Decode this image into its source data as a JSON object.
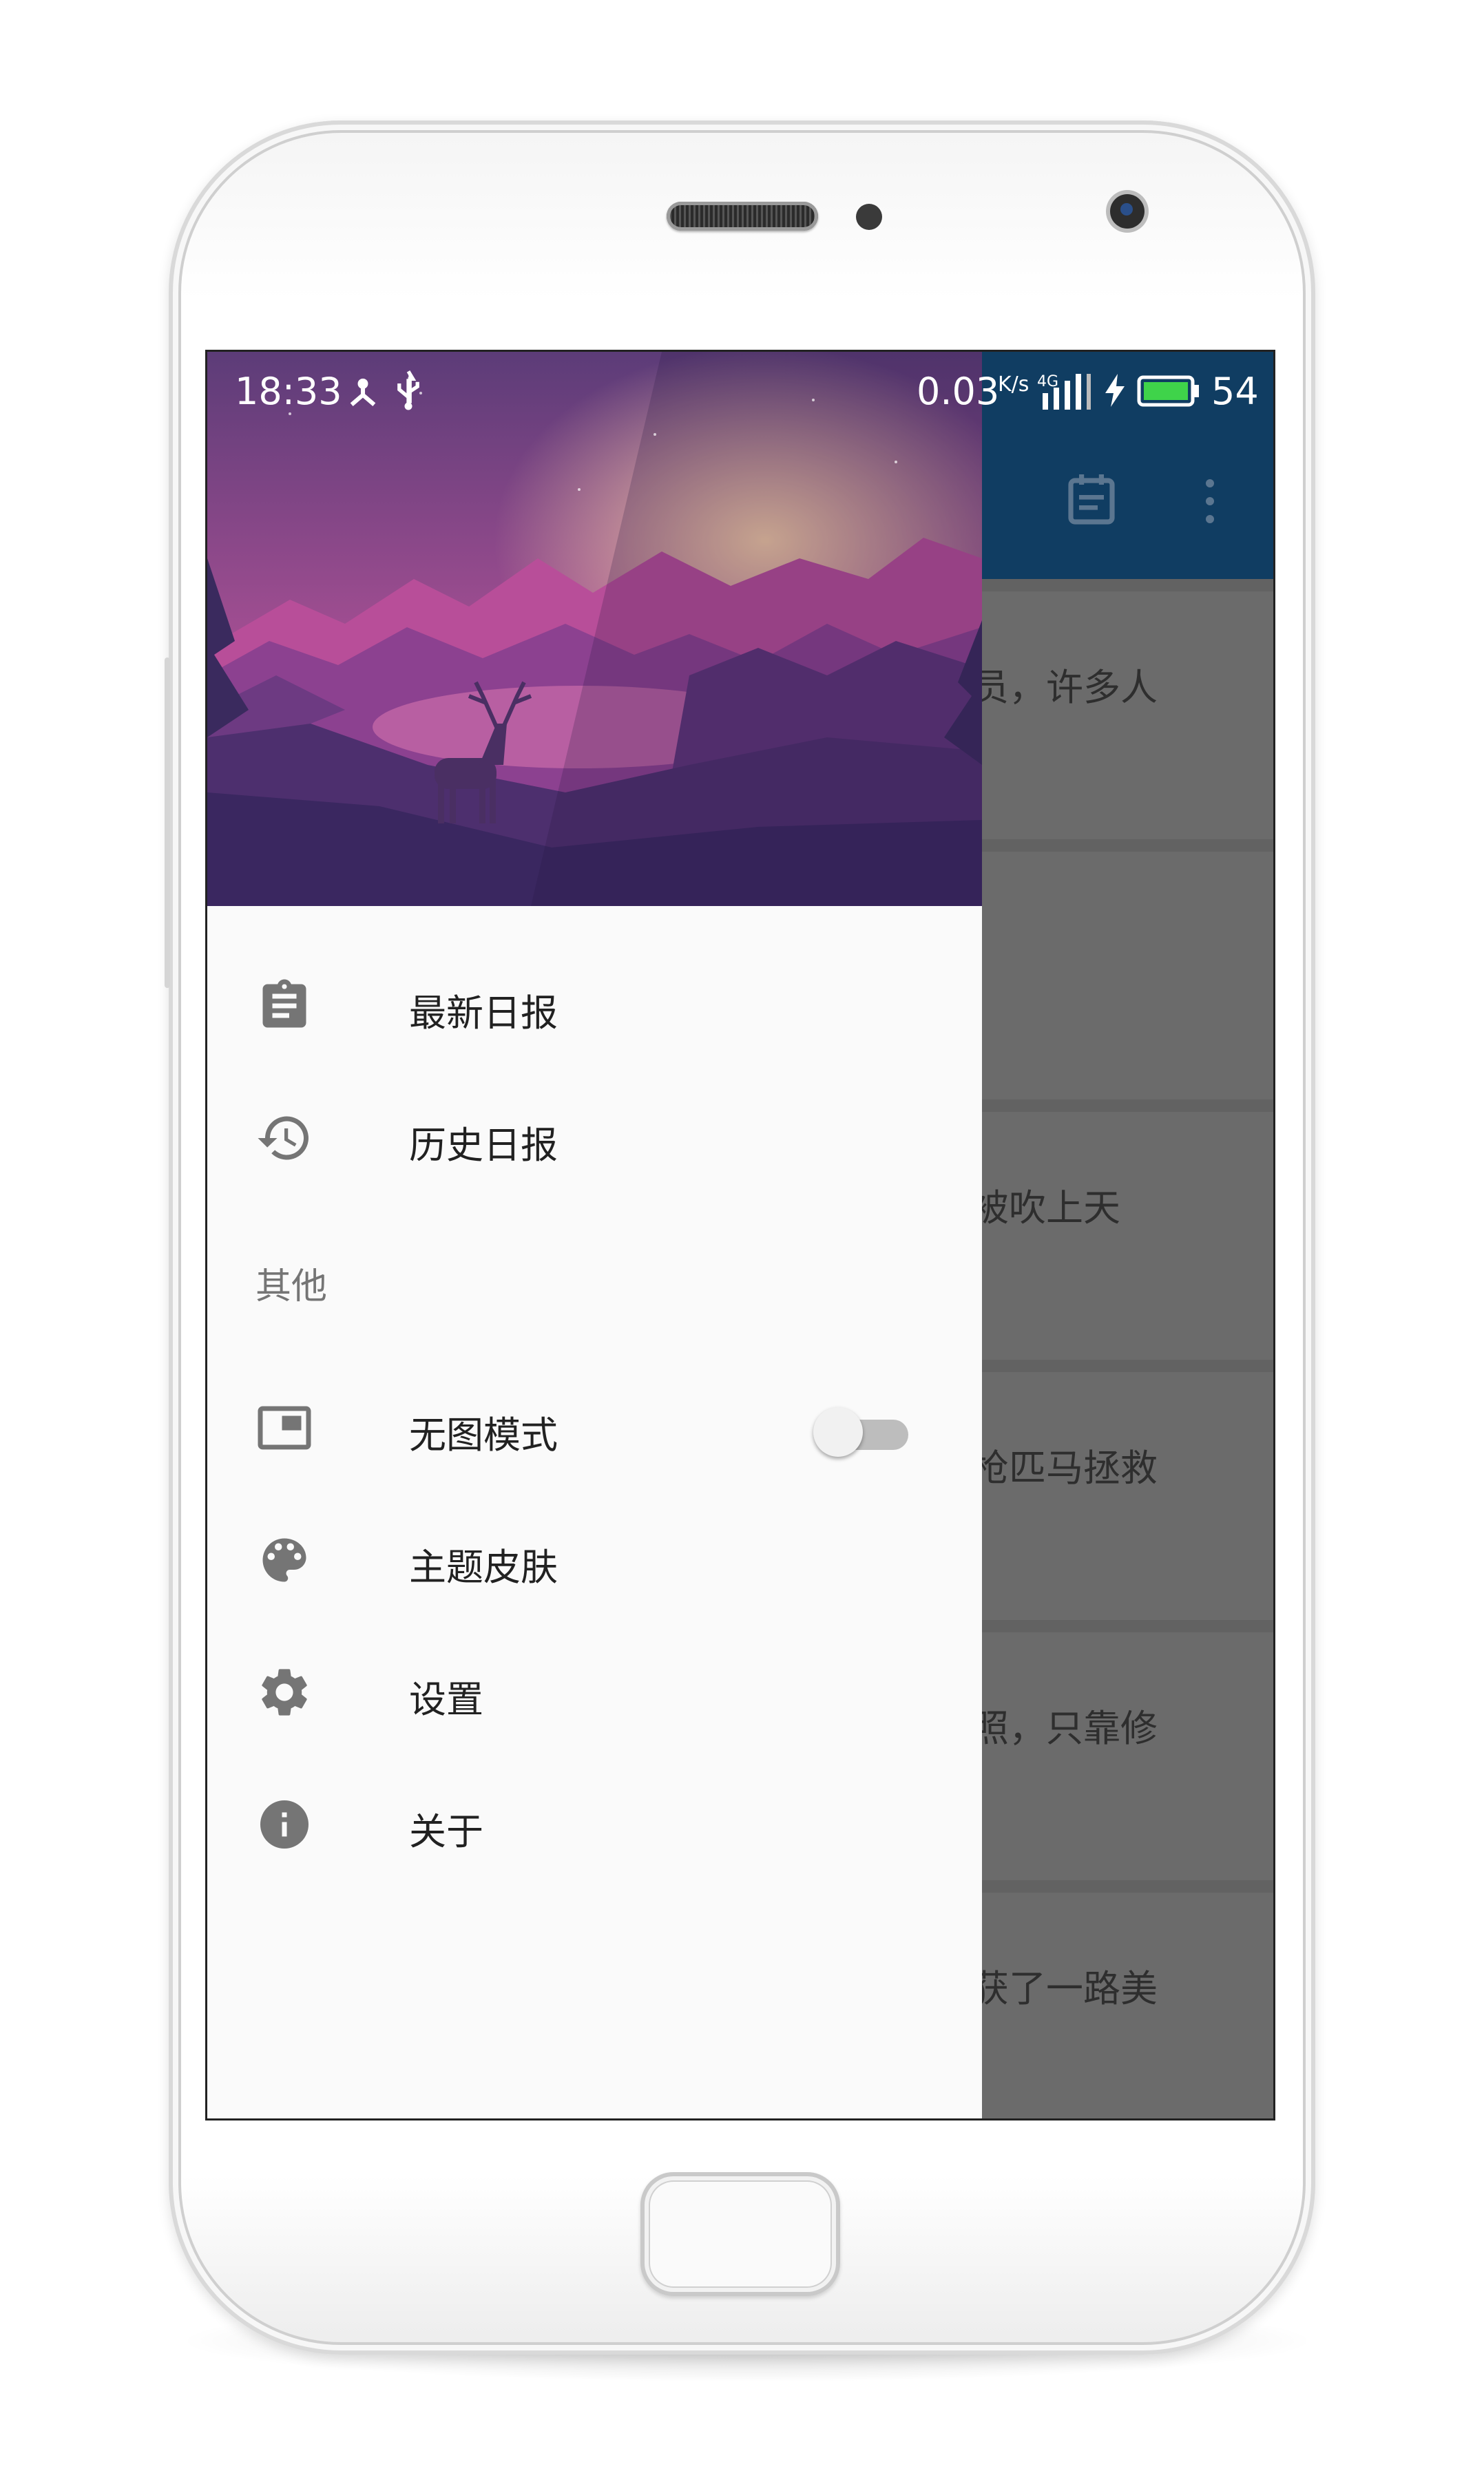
{
  "status_bar": {
    "time": "18:33",
    "net_speed": "0.03",
    "net_unit": "K/s",
    "network_type": "4G",
    "battery_level": "54"
  },
  "background_app": {
    "toolbar_color": "#103d62",
    "list_snippets": [
      "员，许多人",
      "",
      "被吹上天",
      "枪匹马拯救",
      "照，只靠修",
      "获了一路美"
    ]
  },
  "drawer": {
    "menu": [
      {
        "label": "最新日报",
        "icon": "clipboard-icon"
      },
      {
        "label": "历史日报",
        "icon": "history-icon"
      }
    ],
    "section_title": "其他",
    "other_menu": [
      {
        "label": "无图模式",
        "icon": "picture-in-picture-icon",
        "toggle": false
      },
      {
        "label": "主题皮肤",
        "icon": "palette-icon"
      },
      {
        "label": "设置",
        "icon": "gear-icon"
      },
      {
        "label": "关于",
        "icon": "info-icon"
      }
    ]
  },
  "colors": {
    "icon": "#757575",
    "drawer_bg": "#fafafa",
    "header_sky_top": "#5c3c78",
    "header_sky_bottom": "#c45a9a"
  }
}
